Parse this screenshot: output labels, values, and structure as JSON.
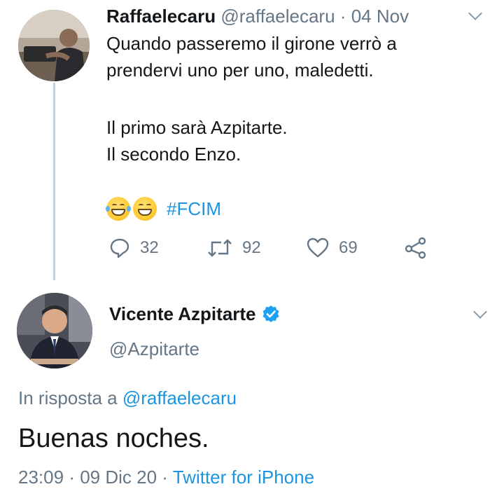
{
  "parent_tweet": {
    "display_name": "Raffaelecaru",
    "handle": "@raffaelecaru",
    "separator": "·",
    "date": "04 Nov",
    "lines": [
      "Quando passeremo il girone verrò a",
      "prendervi uno per uno, maledetti.",
      "Il primo sarà Azpitarte.",
      "Il secondo Enzo."
    ],
    "emojis": [
      "grinning-squinting-face-emoji",
      "beaming-face-emoji"
    ],
    "hashtag": "#FCIM",
    "actions": {
      "replies": "32",
      "retweets": "92",
      "likes": "69"
    },
    "menu_icon": "chevron-down-icon"
  },
  "reply_tweet": {
    "display_name": "Vicente Azpitarte",
    "verified": true,
    "handle": "@Azpitarte",
    "reply_prefix": "In risposta a",
    "reply_mention": "@raffaelecaru",
    "text": "Buenas noches.",
    "time": "23:09",
    "separator": "·",
    "date": "09 Dic 20",
    "separator2": "·",
    "source": "Twitter for iPhone",
    "menu_icon": "chevron-down-icon"
  },
  "colors": {
    "link": "#1b95e0",
    "secondary_text": "#657786",
    "primary_text": "#14171a",
    "thread_line": "#c4cfd6",
    "verified": "#1da1f2"
  }
}
